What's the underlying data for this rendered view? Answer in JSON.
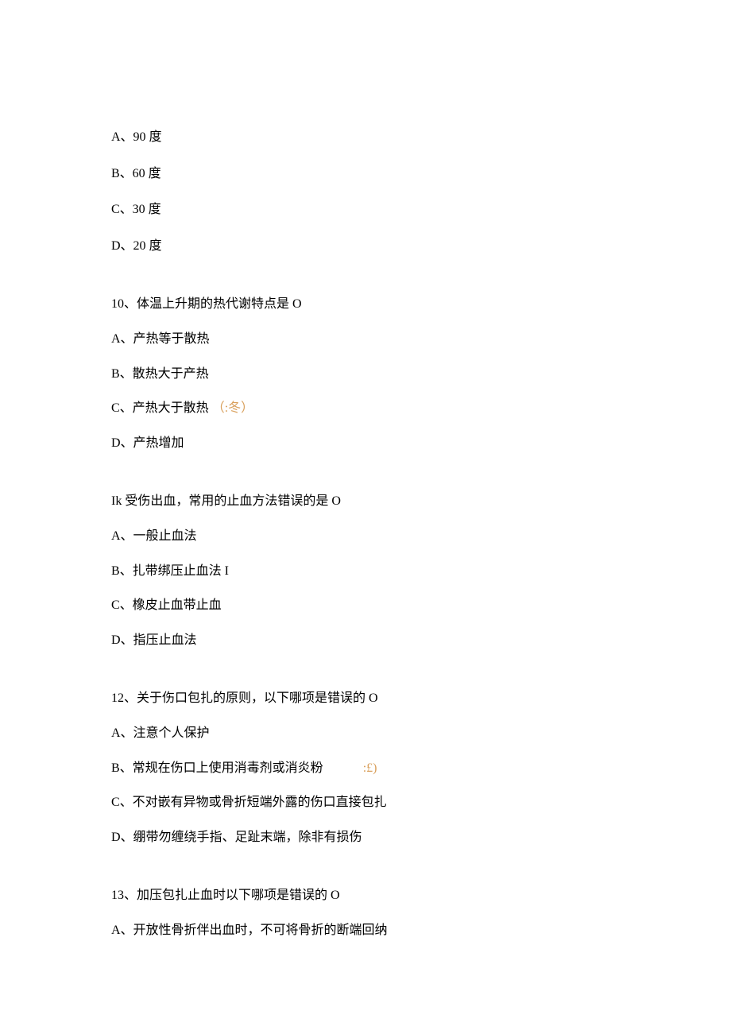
{
  "q9_options": {
    "a": "A、90 度",
    "b": "B、60 度",
    "c": "C、30 度",
    "d": "D、20 度"
  },
  "q10": {
    "stem": "10、体温上升期的热代谢特点是 O",
    "a": "A、产热等于散热",
    "b": "B、散热大于产热",
    "c_prefix": "C、产热大于散热",
    "c_marker": "（:冬）",
    "d": "D、产热增加"
  },
  "q11": {
    "stem": "Ik 受伤出血，常用的止血方法错误的是 O",
    "a": "A、一般止血法",
    "b": "B、扎带绑压止血法 I",
    "c": "C、橡皮止血带止血",
    "d": "D、指压止血法"
  },
  "q12": {
    "stem": "12、关于伤口包扎的原则，以下哪项是错误的 O",
    "a": "A、注意个人保护",
    "b_prefix": "B、常规在伤口上使用消毒剂或消炎粉",
    "b_marker": ":£)",
    "c": "C、不对嵌有异物或骨折短端外露的伤口直接包扎",
    "d": "D、绷带勿缠绕手指、足趾末端，除非有损伤"
  },
  "q13": {
    "stem": "13、加压包扎止血时以下哪项是错误的 O",
    "a": "A、开放性骨折伴出血时，不可将骨折的断端回纳"
  }
}
